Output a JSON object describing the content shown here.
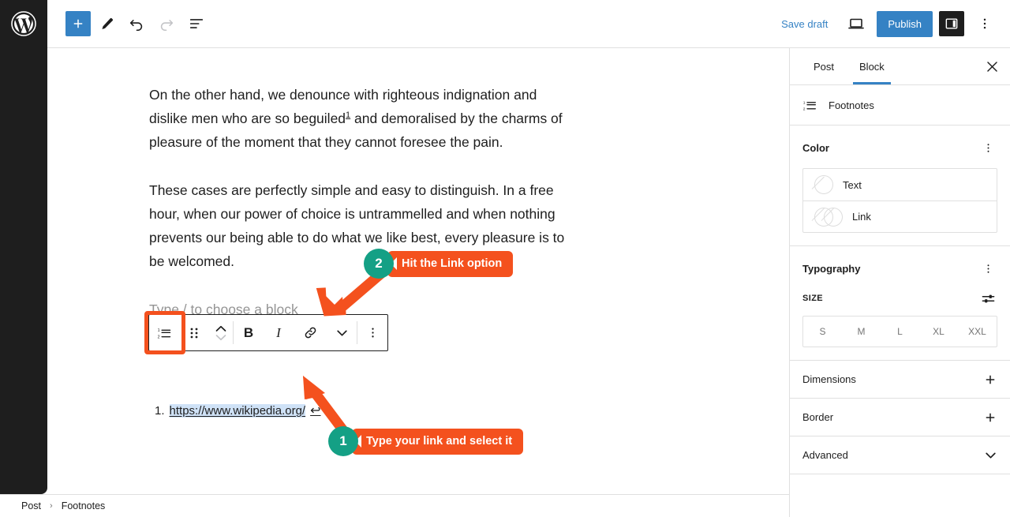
{
  "topbar": {
    "logo_icon": "wordpress-logo-icon",
    "tools": [
      {
        "name": "add-block-button",
        "icon": "plus-icon",
        "label": "+"
      },
      {
        "name": "edit-tool-button",
        "icon": "pencil-icon",
        "label": ""
      },
      {
        "name": "undo-button",
        "icon": "undo-arrow-icon",
        "label": ""
      },
      {
        "name": "redo-button",
        "icon": "redo-arrow-icon",
        "label": ""
      },
      {
        "name": "document-overview-button",
        "icon": "list-view-icon",
        "label": ""
      }
    ],
    "save_draft_label": "Save draft",
    "preview_icon": "laptop-preview-icon",
    "publish_label": "Publish",
    "sidebar_toggle_icon": "settings-panel-icon",
    "options_icon": "kebab-menu-icon",
    "accent_blue": "#3582c4",
    "dark": "#1e1e1e"
  },
  "editor": {
    "paragraph_1_before": "On the other hand, we denounce with righteous indignation and dislike men who are so beguiled",
    "paragraph_1_footnote_ref": "1",
    "paragraph_1_after": " and demoralised by the charms of pleasure of the moment that they cannot foresee the pain.",
    "paragraph_2": "These cases are perfectly simple and easy to distinguish. In a free hour, when our power of choice is untrammelled and when nothing prevents our being able to do what we like best, every pleasure is to be welcomed.",
    "placeholder": "Type / to choose a block",
    "footnote": {
      "number": "1.",
      "link_text": "https://www.wikipedia.org/",
      "backlink_icon": "return-arrow-icon",
      "backlink_glyph": "↩",
      "selection_color": "#cfe2f7"
    }
  },
  "block_toolbar": {
    "buttons": [
      {
        "name": "block-type-footnotes-button",
        "icon": "footnotes-icon",
        "label": ""
      },
      {
        "name": "drag-handle",
        "icon": "drag-dots-icon",
        "label": ""
      },
      {
        "name": "move-up-down-button",
        "icon": "chevron-up-down-icon",
        "label": ""
      },
      {
        "name": "bold-button",
        "icon": "bold-icon",
        "label": "B"
      },
      {
        "name": "italic-button",
        "icon": "italic-icon",
        "label": "I"
      },
      {
        "name": "link-button",
        "icon": "link-icon",
        "label": ""
      },
      {
        "name": "more-formatting-button",
        "icon": "chevron-down-icon",
        "label": ""
      },
      {
        "name": "block-options-button",
        "icon": "kebab-menu-icon",
        "label": ""
      }
    ],
    "highlight_color": "#f4511e"
  },
  "annotations": {
    "accent_red": "#f4511e",
    "accent_teal": "#14a085",
    "steps": [
      {
        "number": "2",
        "text": "Hit the Link option"
      },
      {
        "number": "1",
        "text": "Type your link and select it"
      }
    ]
  },
  "sidebar": {
    "tabs": [
      {
        "name": "tab-post",
        "label": "Post",
        "active": false
      },
      {
        "name": "tab-block",
        "label": "Block",
        "active": true
      }
    ],
    "close_icon": "close-x-icon",
    "block_name": "Footnotes",
    "block_icon": "footnotes-icon",
    "color": {
      "title": "Color",
      "options_icon": "kebab-menu-icon",
      "rows": [
        {
          "name": "color-row-text",
          "label": "Text",
          "swatch": "none"
        },
        {
          "name": "color-row-link",
          "label": "Link",
          "swatch": "dual"
        }
      ]
    },
    "typography": {
      "title": "Typography",
      "options_icon": "kebab-menu-icon",
      "size_label": "SIZE",
      "size_settings_icon": "sliders-icon",
      "sizes": [
        "S",
        "M",
        "L",
        "XL",
        "XXL"
      ]
    },
    "collapsibles": [
      {
        "name": "panel-dimensions",
        "label": "Dimensions",
        "icon": "plus-icon"
      },
      {
        "name": "panel-border",
        "label": "Border",
        "icon": "plus-icon"
      },
      {
        "name": "panel-advanced",
        "label": "Advanced",
        "icon": "chevron-down-icon"
      }
    ]
  },
  "breadcrumb": {
    "items": [
      "Post",
      "Footnotes"
    ],
    "separator": "›"
  }
}
